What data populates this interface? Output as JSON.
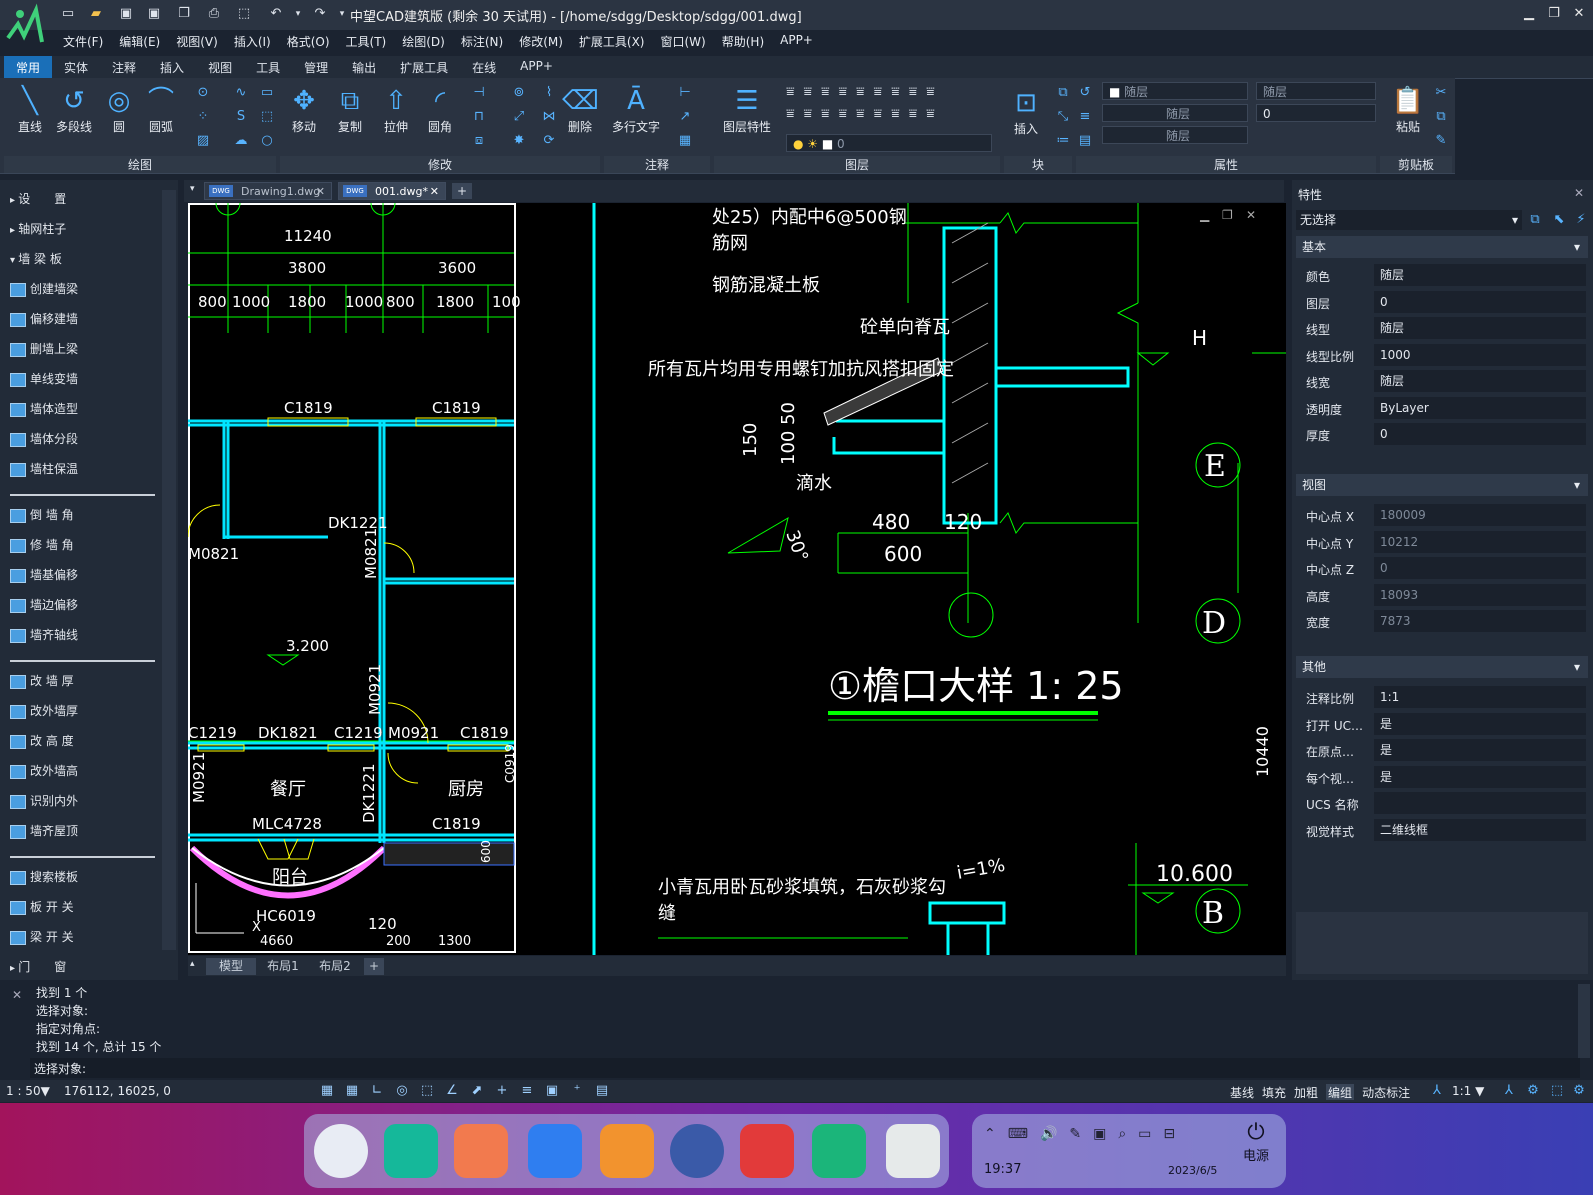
{
  "title_bar": {
    "title": "中望CAD建筑版 (剩余 30 天试用) - [/home/sdgg/Desktop/sdgg/001.dwg]"
  },
  "menus": [
    "文件(F)",
    "编辑(E)",
    "视图(V)",
    "插入(I)",
    "格式(O)",
    "工具(T)",
    "绘图(D)",
    "标注(N)",
    "修改(M)",
    "扩展工具(X)",
    "窗口(W)",
    "帮助(H)",
    "APP+"
  ],
  "ribbon_tabs": [
    "常用",
    "实体",
    "注释",
    "插入",
    "视图",
    "工具",
    "管理",
    "输出",
    "扩展工具",
    "在线",
    "APP+"
  ],
  "ribbon": {
    "draw": {
      "line": "直线",
      "polyline": "多段线",
      "circle": "圆",
      "arc": "圆弧",
      "group": "绘图"
    },
    "modify": {
      "move": "移动",
      "copy": "复制",
      "stretch": "拉伸",
      "fillet": "圆角",
      "erase": "删除",
      "group": "修改"
    },
    "annotate": {
      "mtext": "多行文字",
      "group": "注释"
    },
    "layer": {
      "props": "图层特性",
      "group": "图层",
      "layer_value": "0"
    },
    "block": {
      "insert": "插入",
      "group": "块"
    },
    "properties": {
      "group": "属性",
      "color": "随层",
      "linetype": "随层",
      "lineweight": "随层",
      "plotstyle": "随层",
      "value": "0"
    },
    "clipboard": {
      "paste": "粘贴",
      "group": "剪贴板"
    }
  },
  "left_panel": {
    "headers": [
      "设　　置",
      "轴网柱子",
      "墙 梁 板"
    ],
    "items": [
      "创建墙梁",
      "偏移建墙",
      "删墙上梁",
      "单线变墙",
      "墙体造型",
      "墙体分段",
      "墙柱保温"
    ],
    "items2": [
      "倒 墙 角",
      "修 墙 角",
      "墙基偏移",
      "墙边偏移",
      "墙齐轴线"
    ],
    "items3": [
      "改 墙 厚",
      "改外墙厚",
      "改 高 度",
      "改外墙高",
      "识别内外",
      "墙齐屋顶"
    ],
    "items4": [
      "搜索楼板",
      "板 开 关",
      "梁 开 关"
    ],
    "last": "门　　窗"
  },
  "doc_tabs": [
    {
      "label": "Drawing1.dwg"
    },
    {
      "label": "001.dwg*"
    }
  ],
  "layout_tabs": [
    "模型",
    "布局1",
    "布局2"
  ],
  "drawing": {
    "plan_dims": [
      "11240",
      "3800",
      "3600",
      "800",
      "1000",
      "1800",
      "1000",
      "800",
      "1800",
      "100"
    ],
    "plan_labels": [
      "C1819",
      "C1819",
      "DK1221",
      "M0821",
      "M0821",
      "3.200",
      "C1219",
      "DK1821",
      "C1219",
      "M0921",
      "C1819",
      "M0921",
      "餐厅",
      "厨房",
      "MLC4728",
      "C1819",
      "DK1221",
      "阳台",
      "HC6019",
      "120",
      "600",
      "M0921",
      "C0919",
      "X",
      "4660",
      "1300",
      "200"
    ],
    "detail_text": [
      "处25）内配中6@500钢",
      "筋网",
      "钢筋混凝土板",
      "砼单向脊瓦",
      "所有瓦片均用专用螺钉加抗风搭扣固定",
      "150",
      "50",
      "100",
      "滴水",
      "30°",
      "480",
      "120",
      "600",
      "H",
      "E",
      "D",
      "B",
      "①檐口大样  1: 25",
      "小青瓦用卧瓦砂浆填筑，石灰砂浆勾",
      "缝",
      "i=1%",
      "10.600",
      "10440"
    ]
  },
  "properties": {
    "title": "特性",
    "selection": "无选择",
    "basic_header": "基本",
    "basic": [
      {
        "k": "颜色",
        "v": "随层"
      },
      {
        "k": "图层",
        "v": "0"
      },
      {
        "k": "线型",
        "v": "随层"
      },
      {
        "k": "线型比例",
        "v": "1000"
      },
      {
        "k": "线宽",
        "v": "随层"
      },
      {
        "k": "透明度",
        "v": "ByLayer"
      },
      {
        "k": "厚度",
        "v": "0"
      }
    ],
    "view_header": "视图",
    "view": [
      {
        "k": "中心点 X",
        "v": "180009"
      },
      {
        "k": "中心点 Y",
        "v": "10212"
      },
      {
        "k": "中心点 Z",
        "v": "0"
      },
      {
        "k": "高度",
        "v": "18093"
      },
      {
        "k": "宽度",
        "v": "7873"
      }
    ],
    "other_header": "其他",
    "other": [
      {
        "k": "注释比例",
        "v": "1:1"
      },
      {
        "k": "打开 UC…",
        "v": "是"
      },
      {
        "k": "在原点…",
        "v": "是"
      },
      {
        "k": "每个视…",
        "v": "是"
      },
      {
        "k": "UCS 名称",
        "v": ""
      },
      {
        "k": "视觉样式",
        "v": "二维线框"
      }
    ]
  },
  "command": {
    "history": [
      "找到 1 个",
      "选择对象:",
      "指定对角点:",
      "找到 14 个, 总计 15 个"
    ],
    "prompt": "选择对象:"
  },
  "status": {
    "scale": "1 : 50",
    "coords": "176112, 16025, 0",
    "right": [
      "基线",
      "填充",
      "加粗",
      "编组",
      "动态标注"
    ],
    "anno_scale": "1:1"
  },
  "taskbar": {
    "time": "19:37",
    "date": "2023/6/5",
    "power": "电源"
  }
}
